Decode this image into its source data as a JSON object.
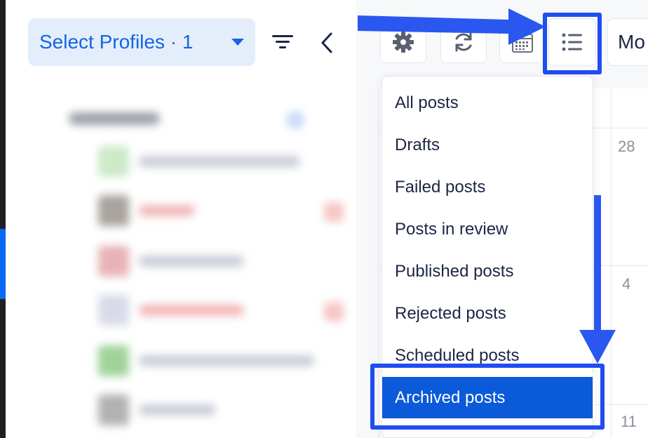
{
  "profiles": {
    "select_label": "Select Profiles · 1"
  },
  "toolbar": {
    "icons": [
      "gear-icon",
      "refresh-icon",
      "calendar-icon",
      "list-icon"
    ],
    "view_select_label": "Mo"
  },
  "calendar": {
    "day_numbers": [
      "28",
      "4",
      "11"
    ]
  },
  "dropdown": {
    "items": [
      {
        "label": "All posts"
      },
      {
        "label": "Drafts"
      },
      {
        "label": "Failed posts"
      },
      {
        "label": "Posts in review"
      },
      {
        "label": "Published posts"
      },
      {
        "label": "Rejected posts"
      },
      {
        "label": "Scheduled posts"
      },
      {
        "label": "Archived posts"
      }
    ],
    "active_index": 7
  },
  "colors": {
    "accent": "#1464e4",
    "highlight": "#1f4df0",
    "active_item": "#0b5ad9",
    "text_dark": "#1c2545"
  }
}
